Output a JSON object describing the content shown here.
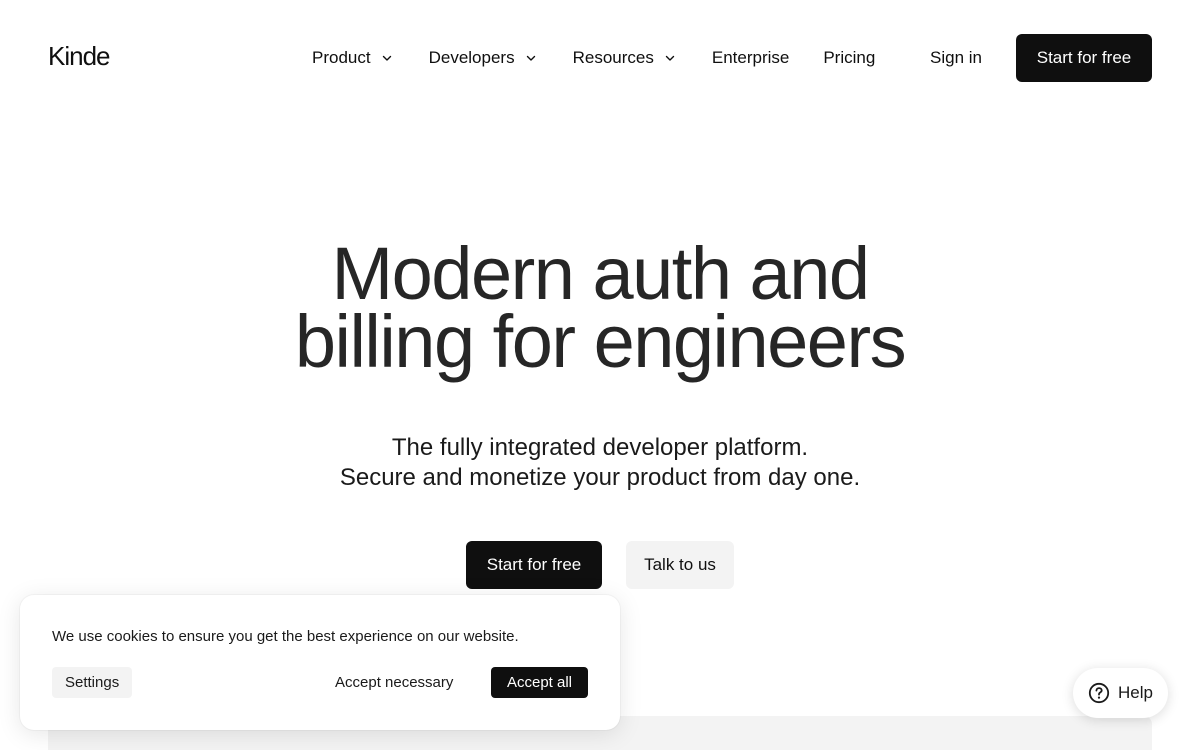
{
  "brand": {
    "name": "Kinde"
  },
  "nav": {
    "items": [
      {
        "label": "Product",
        "dropdown": true
      },
      {
        "label": "Developers",
        "dropdown": true
      },
      {
        "label": "Resources",
        "dropdown": true
      },
      {
        "label": "Enterprise",
        "dropdown": false
      },
      {
        "label": "Pricing",
        "dropdown": false
      }
    ],
    "sign_in": "Sign in",
    "cta": "Start for free"
  },
  "hero": {
    "title_line1": "Modern auth and",
    "title_line2": "billing for engineers",
    "subtitle_line1": "The fully integrated developer platform.",
    "subtitle_line2": "Secure and monetize your product from day one.",
    "primary_cta": "Start for free",
    "secondary_cta": "Talk to us"
  },
  "cookie_banner": {
    "message": "We use cookies to ensure you get the best experience on our website.",
    "settings_label": "Settings",
    "necessary_label": "Accept necessary",
    "accept_all_label": "Accept all"
  },
  "help_widget": {
    "label": "Help",
    "icon": "help-circle-icon"
  },
  "colors": {
    "primary": "#0f0f0f",
    "secondary_bg": "#f3f3f3",
    "background": "#ffffff"
  }
}
